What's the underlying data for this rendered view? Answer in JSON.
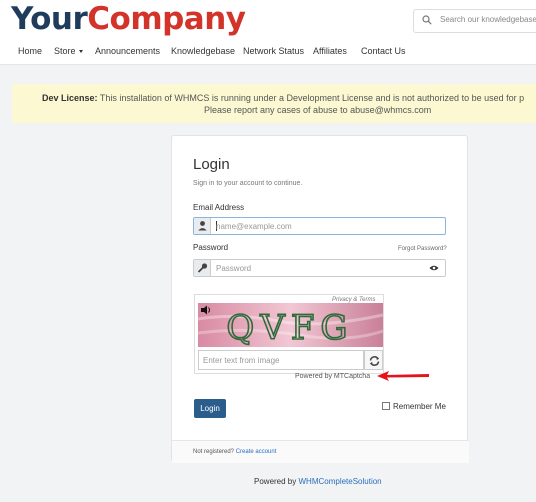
{
  "header": {
    "logo_part1": "Your",
    "logo_part2": "Company",
    "search_placeholder": "Search our knowledgebase..."
  },
  "nav": {
    "items": [
      "Home",
      "Store",
      "Announcements",
      "Knowledgebase",
      "Network Status",
      "Affiliates",
      "Contact Us"
    ]
  },
  "dev_banner": {
    "label": "Dev License:",
    "line1": "This installation of WHMCS is running under a Development License and is not authorized to be used for p",
    "line2": "Please report any cases of abuse to abuse@whmcs.com"
  },
  "login": {
    "title": "Login",
    "subtitle": "Sign in to your account to continue.",
    "email_label": "Email Address",
    "email_placeholder": "name@example.com",
    "password_label": "Password",
    "forgot_link": "Forgot Password?",
    "password_placeholder": "Password",
    "captcha": {
      "privacy_text": "Privacy & Terms",
      "image_text": "QVFG",
      "input_placeholder": "Enter text from image",
      "powered_by": "Powered by MTCaptcha"
    },
    "submit_label": "Login",
    "remember_label": "Remember Me",
    "footer_prefix": "Not registered?",
    "footer_link": "Create account"
  },
  "page_footer": {
    "prefix": "Powered by",
    "link": "WHMCompleteSolution"
  },
  "icons": {
    "search": "search-icon",
    "user": "user-icon",
    "key": "key-icon",
    "eye": "eye-icon",
    "audio": "speaker-icon",
    "refresh": "refresh-icon"
  },
  "colors": {
    "logo_primary": "#1f3c5c",
    "logo_accent": "#d3342a",
    "banner_bg": "#fcf8d2",
    "button_bg": "#2a5c8c",
    "link": "#2a6ebb",
    "annotation_arrow": "#e5141b"
  }
}
